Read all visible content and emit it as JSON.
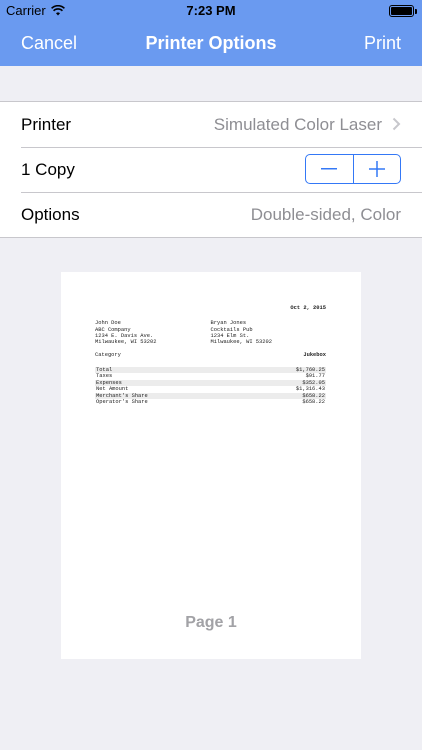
{
  "status_bar": {
    "carrier": "Carrier",
    "time": "7:23 PM",
    "battery_level": 1.0
  },
  "nav": {
    "cancel_label": "Cancel",
    "title": "Printer Options",
    "print_label": "Print",
    "bar_color": "#6a9af0"
  },
  "options": {
    "printer": {
      "label": "Printer",
      "value": "Simulated Color Laser"
    },
    "copies": {
      "label": "1 Copy",
      "minus": "−",
      "plus": "+"
    },
    "options": {
      "label": "Options",
      "value": "Double-sided, Color"
    }
  },
  "preview": {
    "date": "Oct 2, 2015",
    "sender": [
      "John Doe",
      "ABC Company",
      "1234 E. Davis Ave.",
      "Milwaukee, WI 53202"
    ],
    "recipient": [
      "Bryan Jones",
      "Cocktails Pub",
      "1234 Elm St.",
      "Milwaukee, WI 53202"
    ],
    "category_header": "Category",
    "jukebox_header": "Jukebox",
    "rows": [
      {
        "label": "Total",
        "value": "$1,760.25"
      },
      {
        "label": "Taxes",
        "value": "$91.77"
      },
      {
        "label": "Expenses",
        "value": "$352.05"
      },
      {
        "label": "Net Amount",
        "value": "$1,316.43"
      },
      {
        "label": "Merchant's Share",
        "value": "$658.22"
      },
      {
        "label": "Operator's Share",
        "value": "$658.22"
      }
    ],
    "page_label": "Page 1"
  }
}
